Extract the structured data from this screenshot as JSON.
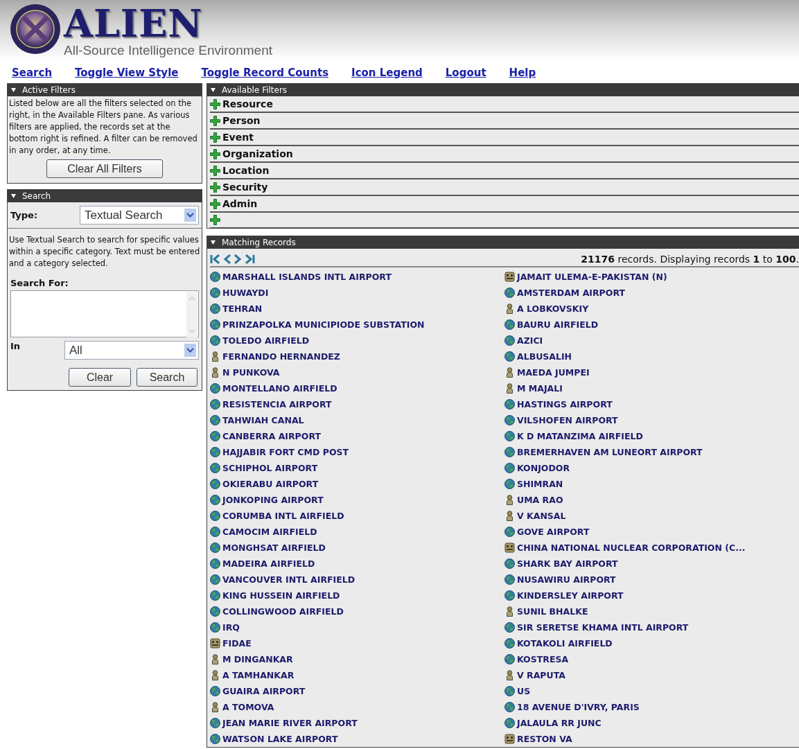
{
  "header": {
    "title": "ALIEN",
    "subtitle": "All-Source Intelligence Environment"
  },
  "nav": [
    {
      "label": "Search"
    },
    {
      "label": "Toggle View Style"
    },
    {
      "label": "Toggle Record Counts"
    },
    {
      "label": "Icon Legend"
    },
    {
      "label": "Logout"
    },
    {
      "label": "Help"
    }
  ],
  "active_filters": {
    "title": "Active Filters",
    "expanded": true,
    "description": "Listed below are all the filters selected on the right, in the Available Filters pane.  As various filters are applied, the records set at the bottom right is refined.  A filter can be removed in any order, at any time.",
    "button": "Clear All Filters"
  },
  "search": {
    "title": "Search",
    "expanded": true,
    "type_label": "Type:",
    "type_value": "Textual Search",
    "description": "Use Textual Search to search for specific values within a specific category.  Text must be entered and a category selected.",
    "search_for_label": "Search For:",
    "in_label": "In",
    "in_value": "All",
    "buttons": [
      "Clear",
      "Search"
    ]
  },
  "available_filters": {
    "title": "Available Filters",
    "expanded": true,
    "items": [
      {
        "kind": "category",
        "label": "Resource"
      },
      {
        "kind": "category",
        "label": "Person"
      },
      {
        "kind": "category",
        "label": "Event"
      },
      {
        "kind": "category",
        "label": "Organization"
      },
      {
        "kind": "category",
        "label": "Location"
      },
      {
        "kind": "category",
        "label": "Security"
      },
      {
        "kind": "category",
        "label": "Admin"
      },
      {
        "kind": "blank"
      }
    ]
  },
  "matching_records": {
    "title": "Matching Records",
    "expanded": true,
    "summary": "**21176** records. Displaying records **1** to **100**.",
    "columns": [
      [
        {
          "kind": "location",
          "name": "MARSHALL ISLANDS INTL AIRPORT"
        },
        {
          "kind": "location",
          "name": "HUWAYDI"
        },
        {
          "kind": "location",
          "name": "TEHRAN"
        },
        {
          "kind": "location",
          "name": "PRINZAPOLKA MUNICIPIODE SUBSTATION"
        },
        {
          "kind": "location",
          "name": "TOLEDO AIRFIELD"
        },
        {
          "kind": "person",
          "name": "FERNANDO HERNANDEZ"
        },
        {
          "kind": "person",
          "name": "N PUNKOVA"
        },
        {
          "kind": "location",
          "name": "MONTELLANO AIRFIELD"
        },
        {
          "kind": "location",
          "name": "RESISTENCIA AIRPORT"
        },
        {
          "kind": "location",
          "name": "TAHWIAH CANAL"
        },
        {
          "kind": "location",
          "name": "CANBERRA AIRPORT"
        },
        {
          "kind": "location",
          "name": "HAJJABIR FORT CMD POST"
        },
        {
          "kind": "location",
          "name": "SCHIPHOL AIRPORT"
        },
        {
          "kind": "location",
          "name": "OKIERABU AIRPORT"
        },
        {
          "kind": "location",
          "name": "JONKOPING AIRPORT"
        },
        {
          "kind": "location",
          "name": "CORUMBA INTL AIRFIELD"
        },
        {
          "kind": "location",
          "name": "CAMOCIM AIRFIELD"
        },
        {
          "kind": "location",
          "name": "MONGHSAT AIRFIELD"
        },
        {
          "kind": "location",
          "name": "MADEIRA AIRFIELD"
        },
        {
          "kind": "location",
          "name": "VANCOUVER INTL AIRFIELD"
        },
        {
          "kind": "location",
          "name": "KING HUSSEIN AIRFIELD"
        },
        {
          "kind": "location",
          "name": "COLLINGWOOD AIRFIELD"
        },
        {
          "kind": "location",
          "name": "IRQ"
        },
        {
          "kind": "organization",
          "name": "FIDAE"
        },
        {
          "kind": "person",
          "name": "M DINGANKAR"
        },
        {
          "kind": "person",
          "name": "A TAMHANKAR"
        },
        {
          "kind": "location",
          "name": "GUAIRA AIRPORT"
        },
        {
          "kind": "person",
          "name": "A TOMOVA"
        },
        {
          "kind": "location",
          "name": "JEAN MARIE RIVER AIRPORT"
        },
        {
          "kind": "location",
          "name": "WATSON LAKE AIRPORT"
        }
      ],
      [
        {
          "kind": "organization",
          "name": "JAMAIT ULEMA-E-PAKISTAN (N)"
        },
        {
          "kind": "location",
          "name": "AMSTERDAM AIRPORT"
        },
        {
          "kind": "person",
          "name": "A LOBKOVSKIY"
        },
        {
          "kind": "location",
          "name": "BAURU AIRFIELD"
        },
        {
          "kind": "location",
          "name": "AZICI"
        },
        {
          "kind": "location",
          "name": "ALBUSALIH"
        },
        {
          "kind": "person",
          "name": "MAEDA JUMPEI"
        },
        {
          "kind": "person",
          "name": "M MAJALI"
        },
        {
          "kind": "location",
          "name": "HASTINGS AIRPORT"
        },
        {
          "kind": "location",
          "name": "VILSHOFEN AIRPORT"
        },
        {
          "kind": "location",
          "name": "K D MATANZIMA AIRFIELD"
        },
        {
          "kind": "location",
          "name": "BREMERHAVEN AM LUNEORT AIRPORT"
        },
        {
          "kind": "location",
          "name": "KONJODOR"
        },
        {
          "kind": "location",
          "name": "SHIMRAN"
        },
        {
          "kind": "person",
          "name": "UMA RAO"
        },
        {
          "kind": "person",
          "name": "V KANSAL"
        },
        {
          "kind": "location",
          "name": "GOVE AIRPORT"
        },
        {
          "kind": "organization",
          "name": "CHINA NATIONAL NUCLEAR CORPORATION (C..."
        },
        {
          "kind": "location",
          "name": "SHARK BAY AIRPORT"
        },
        {
          "kind": "location",
          "name": "NUSAWIRU AIRPORT"
        },
        {
          "kind": "location",
          "name": "KINDERSLEY AIRPORT"
        },
        {
          "kind": "person",
          "name": "SUNIL BHALKE"
        },
        {
          "kind": "location",
          "name": "SIR SERETSE KHAMA INTL AIRPORT"
        },
        {
          "kind": "location",
          "name": "KOTAKOLI AIRFIELD"
        },
        {
          "kind": "location",
          "name": "KOSTRESA"
        },
        {
          "kind": "person",
          "name": "V RAPUTA"
        },
        {
          "kind": "location",
          "name": "US"
        },
        {
          "kind": "location",
          "name": "18 AVENUE D'IVRY, PARIS"
        },
        {
          "kind": "location",
          "name": "JALAULA RR JUNC"
        },
        {
          "kind": "organization",
          "name": "RESTON VA"
        }
      ]
    ]
  }
}
